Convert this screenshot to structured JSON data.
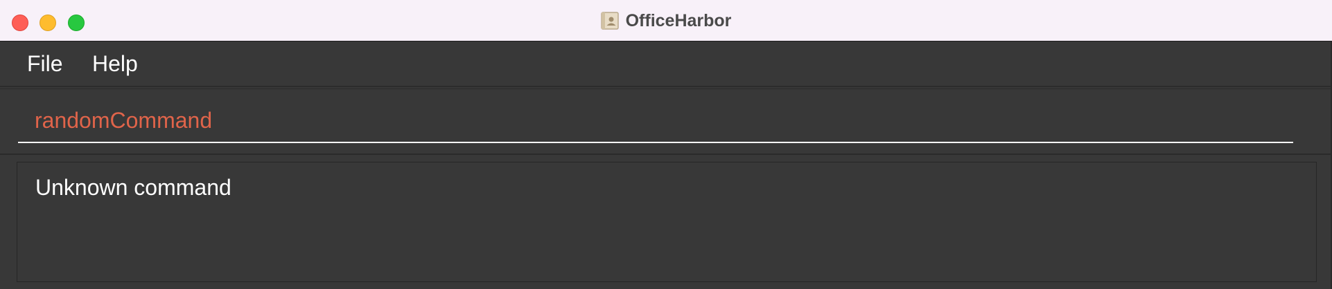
{
  "window": {
    "title": "OfficeHarbor",
    "app_icon": "contacts-book-icon"
  },
  "menubar": {
    "items": [
      {
        "label": "File"
      },
      {
        "label": "Help"
      }
    ]
  },
  "command_box": {
    "value": "randomCommand",
    "text_color": "#e0644a"
  },
  "result_display": {
    "text": "Unknown command"
  },
  "colors": {
    "background": "#383838",
    "titlebar": "#f8f1f9",
    "close": "#fe5f57",
    "minimize": "#febc2e",
    "zoom": "#28c840"
  }
}
